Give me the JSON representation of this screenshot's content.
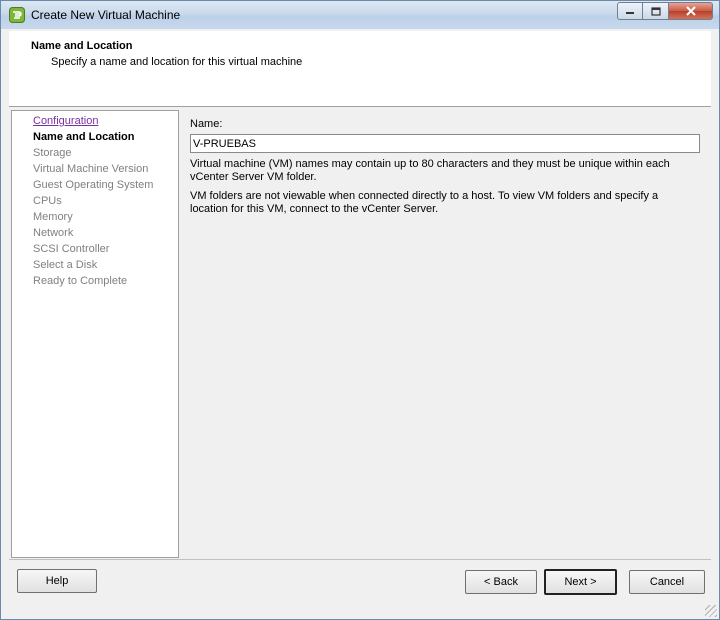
{
  "window": {
    "title": "Create New Virtual Machine"
  },
  "header": {
    "title": "Name and Location",
    "subtitle": "Specify a name and location for this virtual machine"
  },
  "steps": [
    {
      "label": "Configuration",
      "state": "visited"
    },
    {
      "label": "Name and Location",
      "state": "current"
    },
    {
      "label": "Storage",
      "state": "pending"
    },
    {
      "label": "Virtual Machine Version",
      "state": "pending"
    },
    {
      "label": "Guest Operating System",
      "state": "pending"
    },
    {
      "label": "CPUs",
      "state": "pending"
    },
    {
      "label": "Memory",
      "state": "pending"
    },
    {
      "label": "Network",
      "state": "pending"
    },
    {
      "label": "SCSI Controller",
      "state": "pending"
    },
    {
      "label": "Select a Disk",
      "state": "pending"
    },
    {
      "label": "Ready to Complete",
      "state": "pending"
    }
  ],
  "form": {
    "name_label": "Name:",
    "name_value": "V-PRUEBAS",
    "help_1": "Virtual machine (VM) names may contain up to 80 characters and they must be unique within each vCenter Server VM folder.",
    "help_2": "VM folders are not viewable when connected directly to a host. To view VM folders and specify a location for this VM, connect to the vCenter Server."
  },
  "buttons": {
    "help": "Help",
    "back": "< Back",
    "next": "Next >",
    "cancel": "Cancel"
  },
  "icons": {
    "app": "vsphere-client-icon",
    "minimize": "minimize-icon",
    "maximize": "maximize-icon",
    "close": "close-icon"
  },
  "colors": {
    "link_visited": "#7b30a0",
    "step_pending": "#808080",
    "close_button": "#c75a45"
  }
}
